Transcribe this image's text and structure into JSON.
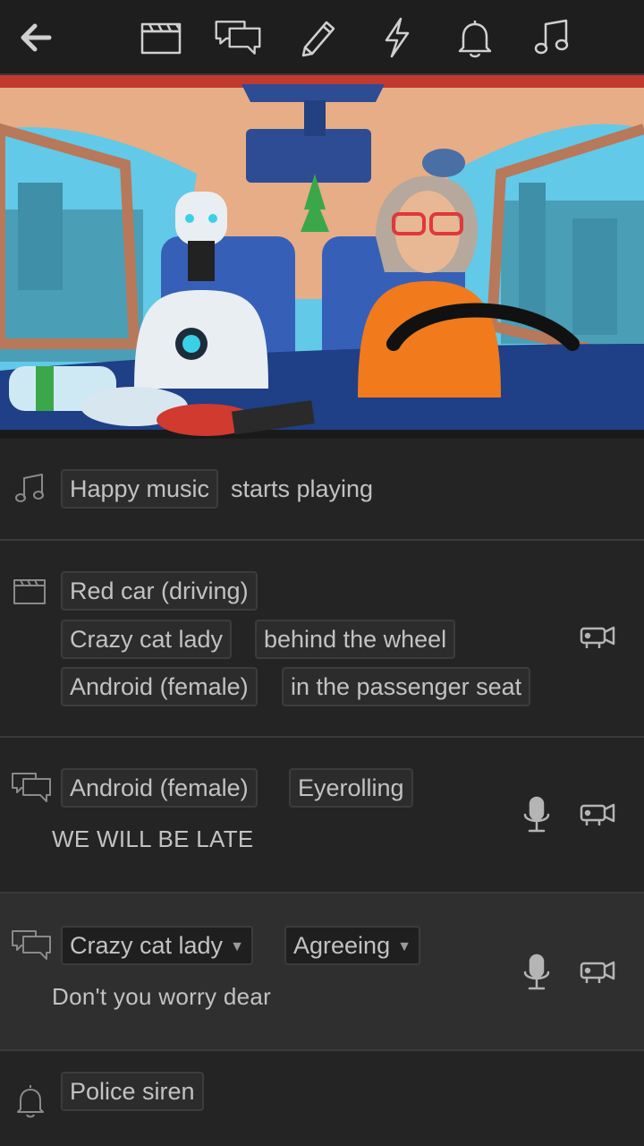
{
  "toolbar": {
    "icons": [
      "back-arrow-icon",
      "clapperboard-icon",
      "speech-bubbles-icon",
      "pencil-icon",
      "lightning-icon",
      "bell-icon",
      "music-note-icon"
    ]
  },
  "colors": {
    "background": "#242424",
    "toolbar": "#1e1e1e",
    "chip_border": "#3c3c3c",
    "text": "#c2c2c2"
  },
  "script": {
    "music_row": {
      "chip": "Happy music",
      "text": "starts playing"
    },
    "scene_row": {
      "location_chip": "Red car (driving)",
      "char1_chip": "Crazy cat lady",
      "char1_position": "behind the wheel",
      "char2_chip": "Android (female)",
      "char2_position": "in the passenger seat"
    },
    "dialogue1": {
      "character": "Android (female)",
      "emotion": "Eyerolling",
      "line": "WE WILL BE LATE"
    },
    "dialogue2": {
      "character": "Crazy cat lady",
      "emotion": "Agreeing",
      "line": "Don't you worry dear"
    },
    "sound_row": {
      "chip": "Police siren"
    }
  }
}
